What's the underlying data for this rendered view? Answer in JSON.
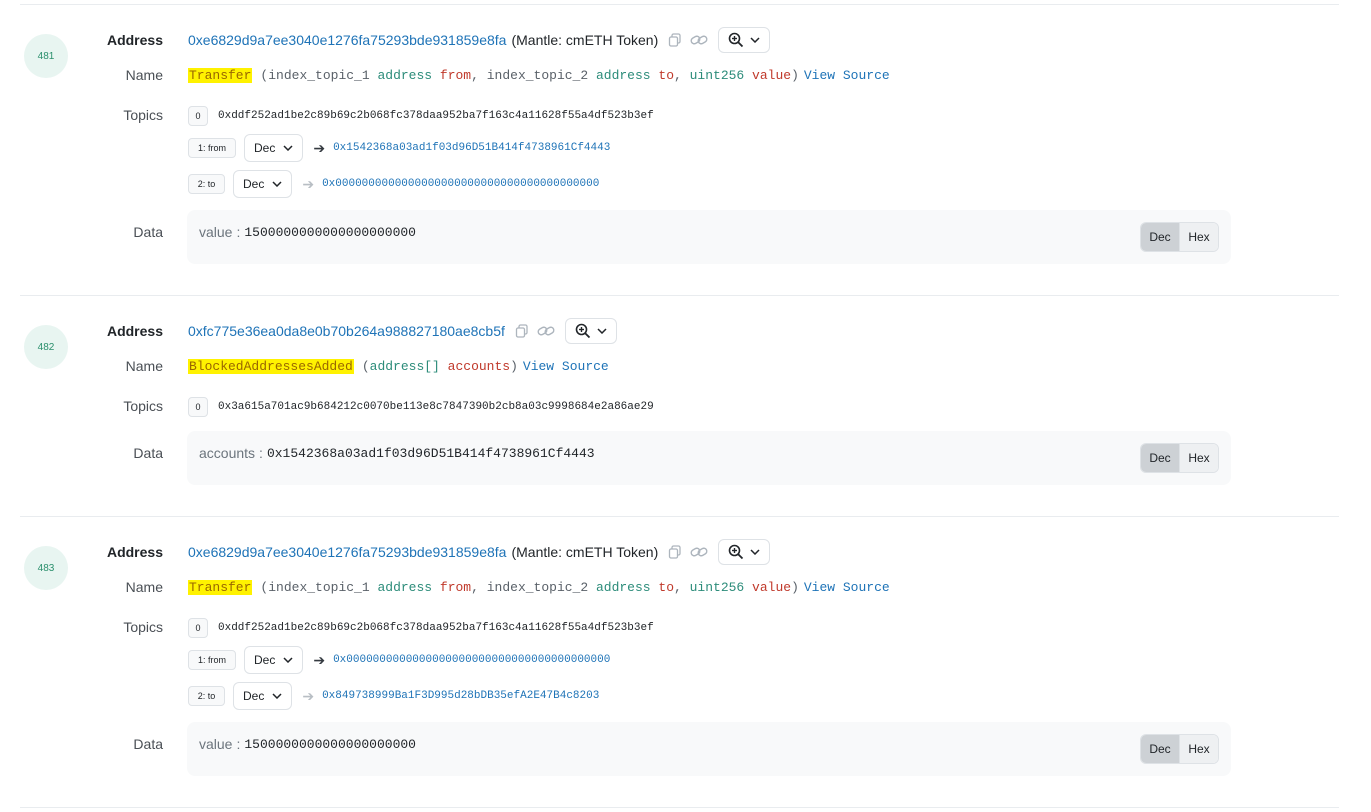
{
  "labels": {
    "address": "Address",
    "name": "Name",
    "topics": "Topics",
    "data": "Data"
  },
  "toggle": {
    "dec": "Dec",
    "hex": "Hex"
  },
  "logs": [
    {
      "index": "481",
      "address": "0xe6829d9a7ee3040e1276fa75293bde931859e8fa",
      "address_name": "(Mantle: cmETH Token)",
      "event": {
        "name": "Transfer",
        "open": "(",
        "params": [
          {
            "prefix": "index_topic_1",
            "type": "address",
            "name": "from",
            "sep": ","
          },
          {
            "prefix": "index_topic_2",
            "type": "address",
            "name": "to",
            "sep": ","
          },
          {
            "prefix": "",
            "type": "uint256",
            "name": "value",
            "sep": ""
          }
        ],
        "close": ")",
        "view_source": "View Source"
      },
      "topics": [
        {
          "tag": "0",
          "value": "0xddf252ad1be2c89b69c2b068fc378daa952ba7f163c4a11628f55a4df523b3ef"
        },
        {
          "tag": "1: from",
          "format": "Dec",
          "value": "0x1542368a03ad1f03d96D51B414f4738961Cf4443"
        },
        {
          "tag": "2: to",
          "format": "Dec",
          "value": "0x0000000000000000000000000000000000000000"
        }
      ],
      "data": {
        "key": "value",
        "sep": ":",
        "value": "1500000000000000000000"
      }
    },
    {
      "index": "482",
      "address": "0xfc775e36ea0da8e0b70b264a988827180ae8cb5f",
      "address_name": "",
      "event": {
        "name": "BlockedAddressesAdded",
        "open": "(",
        "params": [
          {
            "prefix": "",
            "type": "address[]",
            "name": "accounts",
            "sep": ""
          }
        ],
        "close": ")",
        "view_source": "View Source"
      },
      "topics": [
        {
          "tag": "0",
          "value": "0x3a615a701ac9b684212c0070be113e8c7847390b2cb8a03c9998684e2a86ae29"
        }
      ],
      "data": {
        "key": "accounts",
        "sep": ":",
        "value": "0x1542368a03ad1f03d96D51B414f4738961Cf4443"
      }
    },
    {
      "index": "483",
      "address": "0xe6829d9a7ee3040e1276fa75293bde931859e8fa",
      "address_name": "(Mantle: cmETH Token)",
      "event": {
        "name": "Transfer",
        "open": "(",
        "params": [
          {
            "prefix": "index_topic_1",
            "type": "address",
            "name": "from",
            "sep": ","
          },
          {
            "prefix": "index_topic_2",
            "type": "address",
            "name": "to",
            "sep": ","
          },
          {
            "prefix": "",
            "type": "uint256",
            "name": "value",
            "sep": ""
          }
        ],
        "close": ")",
        "view_source": "View Source"
      },
      "topics": [
        {
          "tag": "0",
          "value": "0xddf252ad1be2c89b69c2b068fc378daa952ba7f163c4a11628f55a4df523b3ef"
        },
        {
          "tag": "1: from",
          "format": "Dec",
          "value": "0x0000000000000000000000000000000000000000"
        },
        {
          "tag": "2: to",
          "format": "Dec",
          "value": "0x849738999Ba1F3D995d28bDB35efA2E47B4c8203"
        }
      ],
      "data": {
        "key": "value",
        "sep": ":",
        "value": "1500000000000000000000"
      }
    }
  ]
}
